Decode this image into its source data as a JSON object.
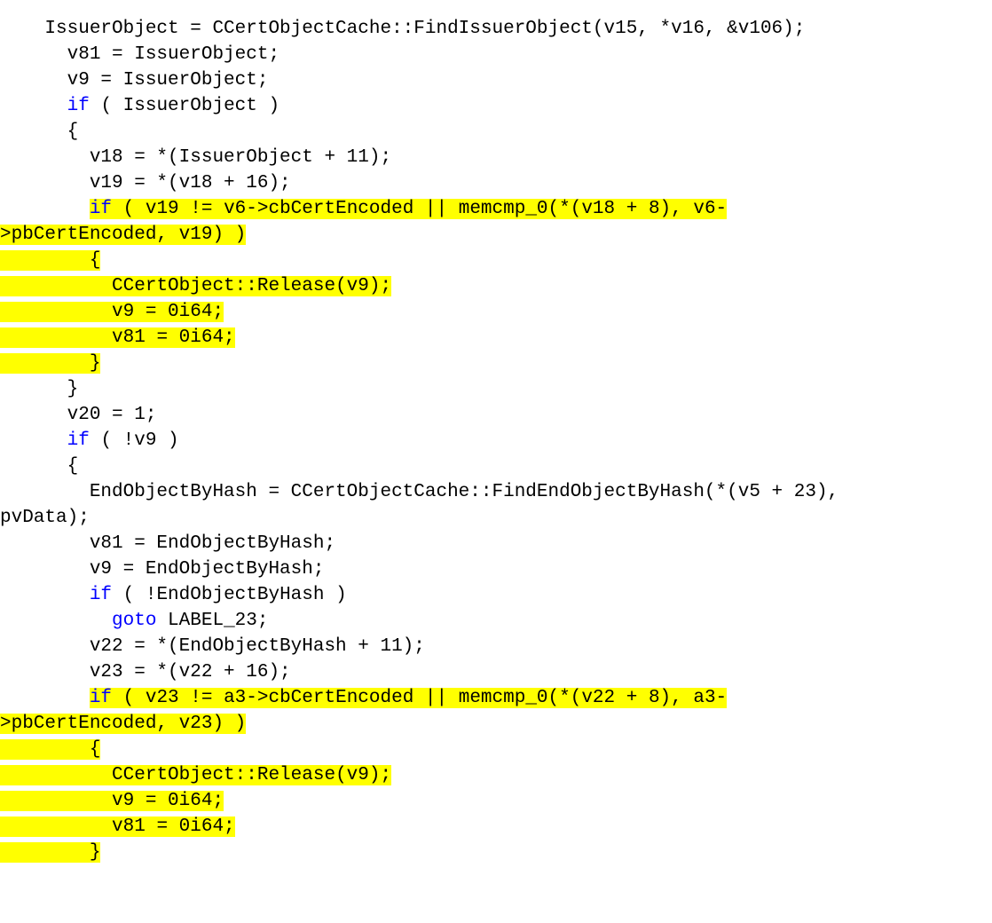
{
  "code": {
    "t01a": "    IssuerObject = CCertObjectCache::FindIssuerObject(v15, *v16, &v106);",
    "t02a": "      v81 = IssuerObject;",
    "t03a": "      v9 = IssuerObject;",
    "t04a": "      ",
    "t04kw": "if",
    "t04b": " ( IssuerObject )",
    "t05a": "      {",
    "t06a": "        v18 = *(IssuerObject + 11);",
    "t07a": "        v19 = *(v18 + 16);",
    "t08pad": "        ",
    "t08kw": "if",
    "t08b": " ( v19 != v6->cbCertEncoded || memcmp_0(*(v18 + 8), v6-",
    "t09a": ">pbCertEncoded, v19) )",
    "t10a": "        {",
    "t11pad": "          ",
    "t11b": "CCertObject::Release(v9);",
    "t12pad": "          ",
    "t12b": "v9 = 0i64;",
    "t13pad": "          ",
    "t13b": "v81 = 0i64;",
    "t14a": "        }",
    "t15a": "      }",
    "t16a": "      v20 = 1;",
    "t17a": "      ",
    "t17kw": "if",
    "t17b": " ( !v9 )",
    "t18a": "      {",
    "t19a": "        EndObjectByHash = CCertObjectCache::FindEndObjectByHash(*(v5 + 23), ",
    "t20a": "pvData);",
    "t21a": "        v81 = EndObjectByHash;",
    "t22a": "        v9 = EndObjectByHash;",
    "t23a": "        ",
    "t23kw": "if",
    "t23b": " ( !EndObjectByHash )",
    "t24a": "          ",
    "t24kw": "goto",
    "t24b": " LABEL_23;",
    "t25a": "        v22 = *(EndObjectByHash + 11);",
    "t26a": "        v23 = *(v22 + 16);",
    "t27pad": "        ",
    "t27kw": "if",
    "t27b": " ( v23 != a3->cbCertEncoded || memcmp_0(*(v22 + 8), a3-",
    "t28a": ">pbCertEncoded, v23) )",
    "t29a": "        {",
    "t30pad": "          ",
    "t30b": "CCertObject::Release(v9);",
    "t31pad": "          ",
    "t31b": "v9 = 0i64;",
    "t32pad": "          ",
    "t32b": "v81 = 0i64;",
    "t33a": "        }"
  }
}
